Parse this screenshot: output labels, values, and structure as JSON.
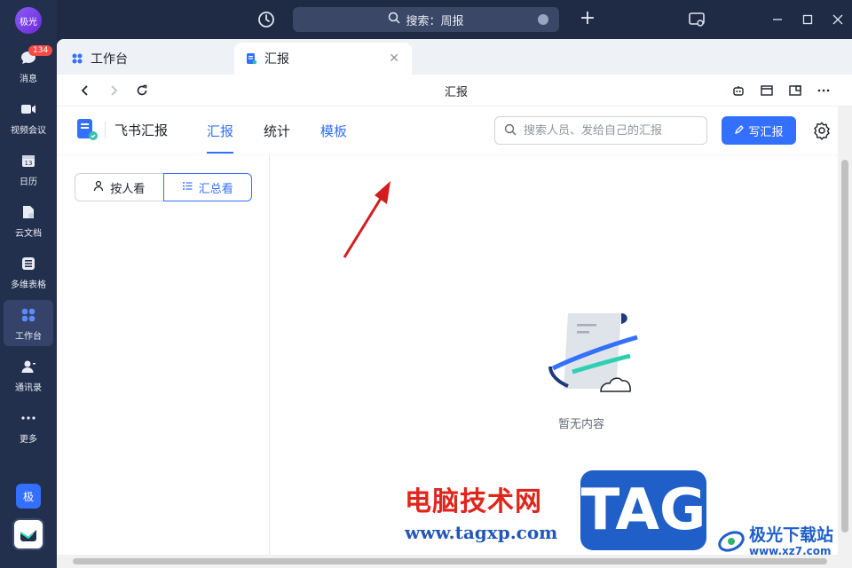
{
  "rail": {
    "avatar": "极光",
    "items": [
      {
        "label": "消息",
        "badge": "134",
        "icon": "chat-bubble-icon"
      },
      {
        "label": "视频会议",
        "icon": "video-camera-icon"
      },
      {
        "label": "日历",
        "icon": "calendar-icon",
        "day": "13"
      },
      {
        "label": "云文档",
        "icon": "cloud-doc-icon"
      },
      {
        "label": "多维表格",
        "icon": "table-icon"
      },
      {
        "label": "工作台",
        "icon": "workbench-grid-icon"
      },
      {
        "label": "通讯录",
        "icon": "contacts-icon"
      },
      {
        "label": "更多",
        "icon": "more-dots-icon"
      }
    ],
    "bottom_badge": "极"
  },
  "titlebar": {
    "search_text": "搜索：周报"
  },
  "tabs": [
    {
      "label": "工作台"
    },
    {
      "label": "汇报"
    }
  ],
  "navbar": {
    "title": "汇报"
  },
  "app": {
    "name": "飞书汇报",
    "tabs": [
      {
        "label": "汇报"
      },
      {
        "label": "统计"
      },
      {
        "label": "模板"
      }
    ],
    "search_placeholder": "搜索人员、发给自己的汇报",
    "write_button": "写汇报"
  },
  "left_panel": {
    "seg_person": "按人看",
    "seg_summary": "汇总看"
  },
  "main": {
    "empty_text": "暂无内容"
  },
  "watermark": {
    "site_cn": "电脑技术网",
    "site_url": "www.tagxp.com",
    "tag": "TAG",
    "brand": "极光下载站",
    "brand_url": "www.xz7.com"
  },
  "colors": {
    "accent": "#3370ff",
    "rail_bg": "#23304d",
    "badge": "#f54a45",
    "annotation_arrow": "#d11f1f"
  }
}
